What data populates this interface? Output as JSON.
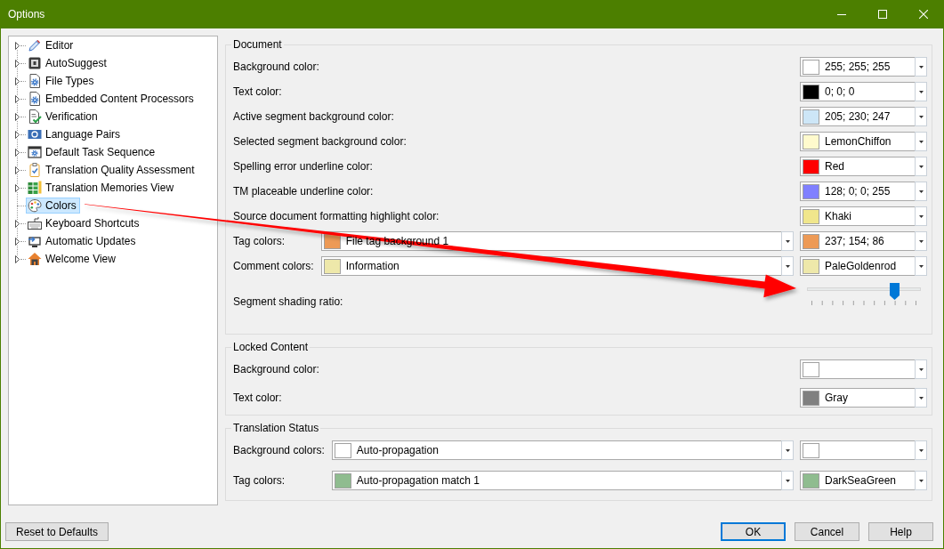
{
  "window": {
    "title": "Options"
  },
  "tree": [
    {
      "label": "Editor",
      "has_children": true,
      "expanded": false,
      "selected": false
    },
    {
      "label": "AutoSuggest",
      "has_children": true,
      "expanded": false,
      "selected": false
    },
    {
      "label": "File Types",
      "has_children": true,
      "expanded": false,
      "selected": false
    },
    {
      "label": "Embedded Content Processors",
      "has_children": true,
      "expanded": false,
      "selected": false
    },
    {
      "label": "Verification",
      "has_children": true,
      "expanded": false,
      "selected": false
    },
    {
      "label": "Language Pairs",
      "has_children": true,
      "expanded": false,
      "selected": false
    },
    {
      "label": "Default Task Sequence",
      "has_children": true,
      "expanded": false,
      "selected": false
    },
    {
      "label": "Translation Quality Assessment",
      "has_children": true,
      "expanded": false,
      "selected": false
    },
    {
      "label": "Translation Memories View",
      "has_children": true,
      "expanded": false,
      "selected": false
    },
    {
      "label": "Colors",
      "has_children": false,
      "expanded": false,
      "selected": true
    },
    {
      "label": "Keyboard Shortcuts",
      "has_children": true,
      "expanded": false,
      "selected": false
    },
    {
      "label": "Automatic Updates",
      "has_children": true,
      "expanded": false,
      "selected": false
    },
    {
      "label": "Welcome View",
      "has_children": true,
      "expanded": false,
      "selected": false
    }
  ],
  "groups": [
    {
      "title": "Document",
      "rows": [
        {
          "kind": "color",
          "label": "Background color:",
          "picker": {
            "value": "255; 255; 255",
            "color": "#ffffff"
          }
        },
        {
          "kind": "color",
          "label": "Text color:",
          "picker": {
            "value": "0; 0; 0",
            "color": "#000000"
          }
        },
        {
          "kind": "color",
          "label": "Active segment background color:",
          "picker": {
            "value": "205; 230; 247",
            "color": "#cde6f7"
          }
        },
        {
          "kind": "color",
          "label": "Selected segment background color:",
          "picker": {
            "value": "LemonChiffon",
            "color": "#fffacd"
          }
        },
        {
          "kind": "color",
          "label": "Spelling error underline color:",
          "picker": {
            "value": "Red",
            "color": "#ff0000"
          }
        },
        {
          "kind": "color",
          "label": "TM placeable underline color:",
          "picker": {
            "value": "128; 0; 0; 255",
            "color": "#8080ff"
          }
        },
        {
          "kind": "color",
          "label": "Source document formatting highlight color:",
          "picker": {
            "value": "Khaki",
            "color": "#f0e68c"
          }
        },
        {
          "kind": "pair",
          "label": "Tag colors:",
          "list": {
            "value": "File tag background 1",
            "color": "#ed9a56"
          },
          "picker": {
            "value": "237; 154; 86",
            "color": "#ed9a56"
          }
        },
        {
          "kind": "pair",
          "label": "Comment colors:",
          "list": {
            "value": "Information",
            "color": "#eee8aa"
          },
          "picker": {
            "value": "PaleGoldenrod",
            "color": "#eee8aa"
          }
        },
        {
          "kind": "slider",
          "label": "Segment shading ratio:",
          "level": 0.8
        }
      ]
    },
    {
      "title": "Locked Content",
      "rows": [
        {
          "kind": "color",
          "label": "Background color:",
          "picker": {
            "color": "#ffffff"
          }
        },
        {
          "kind": "color",
          "label": "Text color:",
          "picker": {
            "value": "Gray",
            "color": "#808080"
          }
        }
      ]
    },
    {
      "title": "Translation Status",
      "rows": [
        {
          "kind": "pair",
          "label": "Background colors:",
          "list": {
            "value": "Auto-propagation",
            "color": "#ffffff"
          },
          "picker": {
            "color": "#ffffff"
          }
        },
        {
          "kind": "pair",
          "label": "Tag colors:",
          "list": {
            "value": "Auto-propagation match 1",
            "color": "#8fbc8f"
          },
          "picker": {
            "value": "DarkSeaGreen",
            "color": "#8fbc8f"
          }
        }
      ]
    }
  ],
  "footer": {
    "left_buttons": [
      {
        "label": "Reset to Defaults",
        "focused": false
      }
    ],
    "right_buttons": [
      {
        "label": "OK",
        "focused": true
      },
      {
        "label": "Cancel",
        "focused": false
      },
      {
        "label": "Help",
        "focused": false
      }
    ]
  }
}
